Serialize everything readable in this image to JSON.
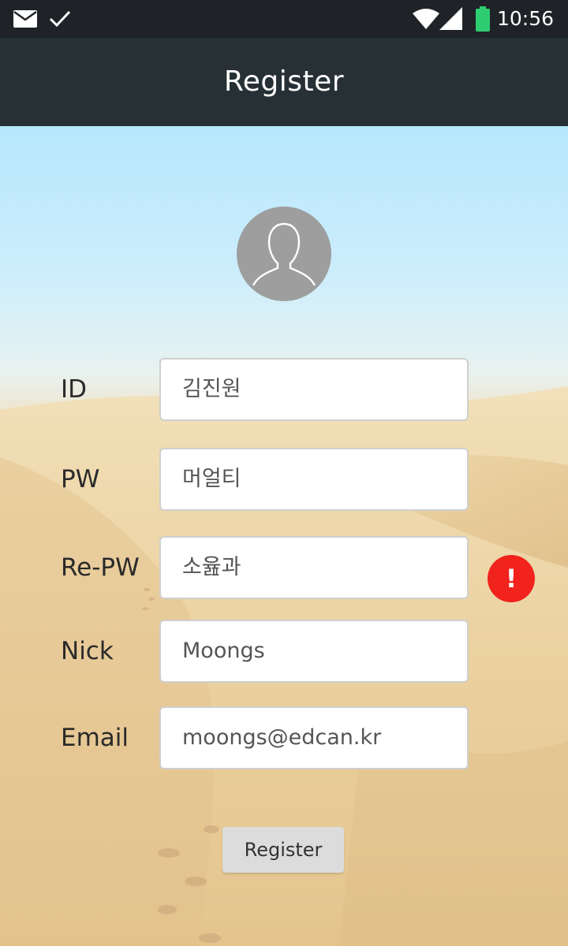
{
  "status_bar": {
    "time": "10:56",
    "left_icons": [
      "mail-icon",
      "check-icon"
    ],
    "right_icons": [
      "wifi-icon",
      "signal-icon",
      "battery-icon"
    ],
    "battery_color": "#2ecc71"
  },
  "app_bar": {
    "title": "Register",
    "background": "#263035"
  },
  "profile": {
    "icon": "user-avatar-icon"
  },
  "form": {
    "id_label": "ID",
    "id_value": "김진원",
    "pw_label": "PW",
    "pw_value": "머얼티",
    "repw_label": "Re-PW",
    "repw_value": "소윮과",
    "repw_error": "!",
    "nick_label": "Nick",
    "nick_value": "Moongs",
    "email_label": "Email",
    "email_value": "moongs@edcan.kr"
  },
  "register_button_label": "Register",
  "colors": {
    "error": "#f2221c",
    "button": "#dcdcdc"
  }
}
